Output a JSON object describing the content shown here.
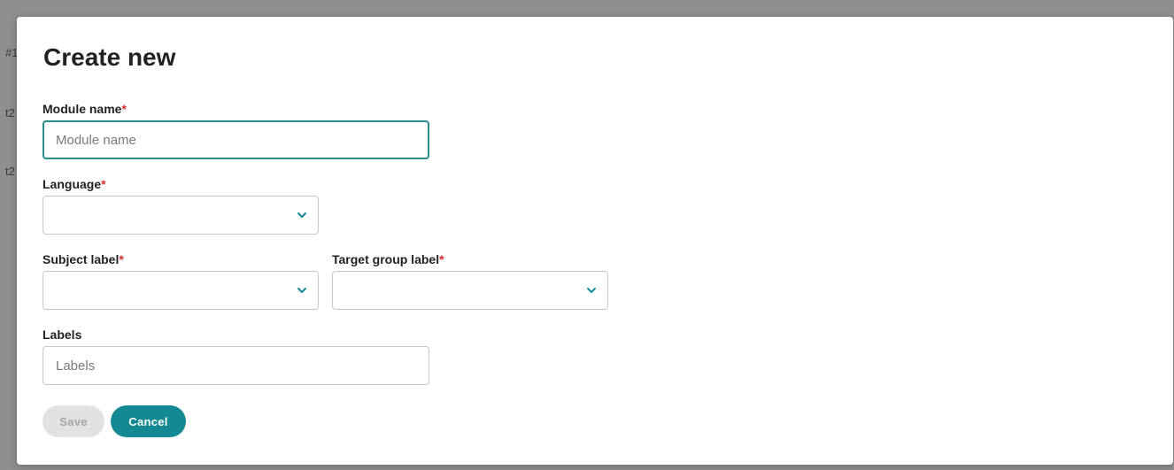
{
  "backdrop": {
    "fragments": [
      "#1",
      "t2",
      "t2"
    ]
  },
  "modal": {
    "title": "Create new",
    "required_marker": "*",
    "fields": {
      "module_name": {
        "label": "Module name",
        "placeholder": "Module name",
        "value": ""
      },
      "language": {
        "label": "Language",
        "value": ""
      },
      "subject_label": {
        "label": "Subject label",
        "value": ""
      },
      "target_group_label": {
        "label": "Target group label",
        "value": ""
      },
      "labels": {
        "label": "Labels",
        "placeholder": "Labels",
        "value": ""
      }
    },
    "buttons": {
      "save": "Save",
      "cancel": "Cancel"
    },
    "icons": {
      "dropdown": "chevron-down-icon"
    },
    "colors": {
      "accent": "#138a93",
      "required": "#d32f2f",
      "disabled_bg": "#e2e2e2"
    }
  }
}
